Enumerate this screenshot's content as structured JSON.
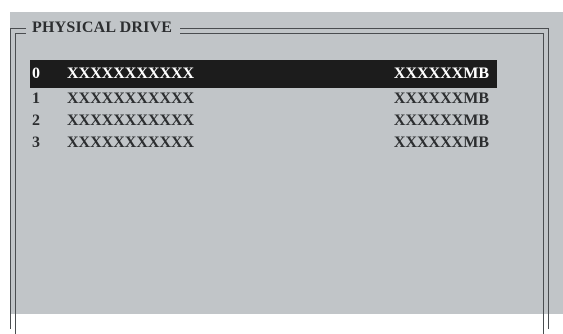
{
  "panel": {
    "title": "PHYSICAL DRIVE"
  },
  "drives": [
    {
      "index": "0",
      "model": "XXXXXXXXXXX",
      "size": "XXXXXXMB",
      "selected": true
    },
    {
      "index": "1",
      "model": "XXXXXXXXXXX",
      "size": "XXXXXXMB",
      "selected": false
    },
    {
      "index": "2",
      "model": "XXXXXXXXXXX",
      "size": "XXXXXXMB",
      "selected": false
    },
    {
      "index": "3",
      "model": "XXXXXXXXXXX",
      "size": "XXXXXXMB",
      "selected": false
    }
  ],
  "colors": {
    "background": "#c1c5c8",
    "text": "#2c2e30",
    "highlight_bg": "#1c1c1c",
    "highlight_text": "#ffffff"
  }
}
